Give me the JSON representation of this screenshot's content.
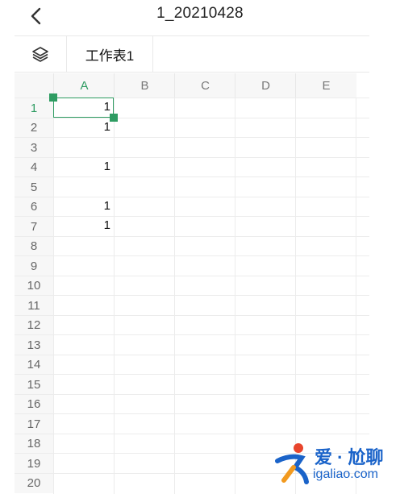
{
  "header": {
    "title": "1_20210428",
    "back_icon": "chevron-left-icon"
  },
  "sheet_bar": {
    "layers_icon": "layers-icon",
    "active_sheet": "工作表1"
  },
  "grid": {
    "columns": [
      "A",
      "B",
      "C",
      "D",
      "E"
    ],
    "rows": [
      "1",
      "2",
      "3",
      "4",
      "5",
      "6",
      "7",
      "8",
      "9",
      "10",
      "11",
      "12",
      "13",
      "14",
      "15",
      "16",
      "17",
      "18",
      "19",
      "20"
    ],
    "cells_col_a": [
      "1",
      "1",
      "",
      "1",
      "",
      "1",
      "1",
      "",
      "",
      "",
      "",
      "",
      "",
      "",
      "",
      "",
      "",
      "",
      "",
      ""
    ],
    "selected_cell": "A1",
    "accent_color": "#2e9c62"
  },
  "watermark": {
    "title": "爱 · 尬聊",
    "url": "igaliao.com"
  }
}
